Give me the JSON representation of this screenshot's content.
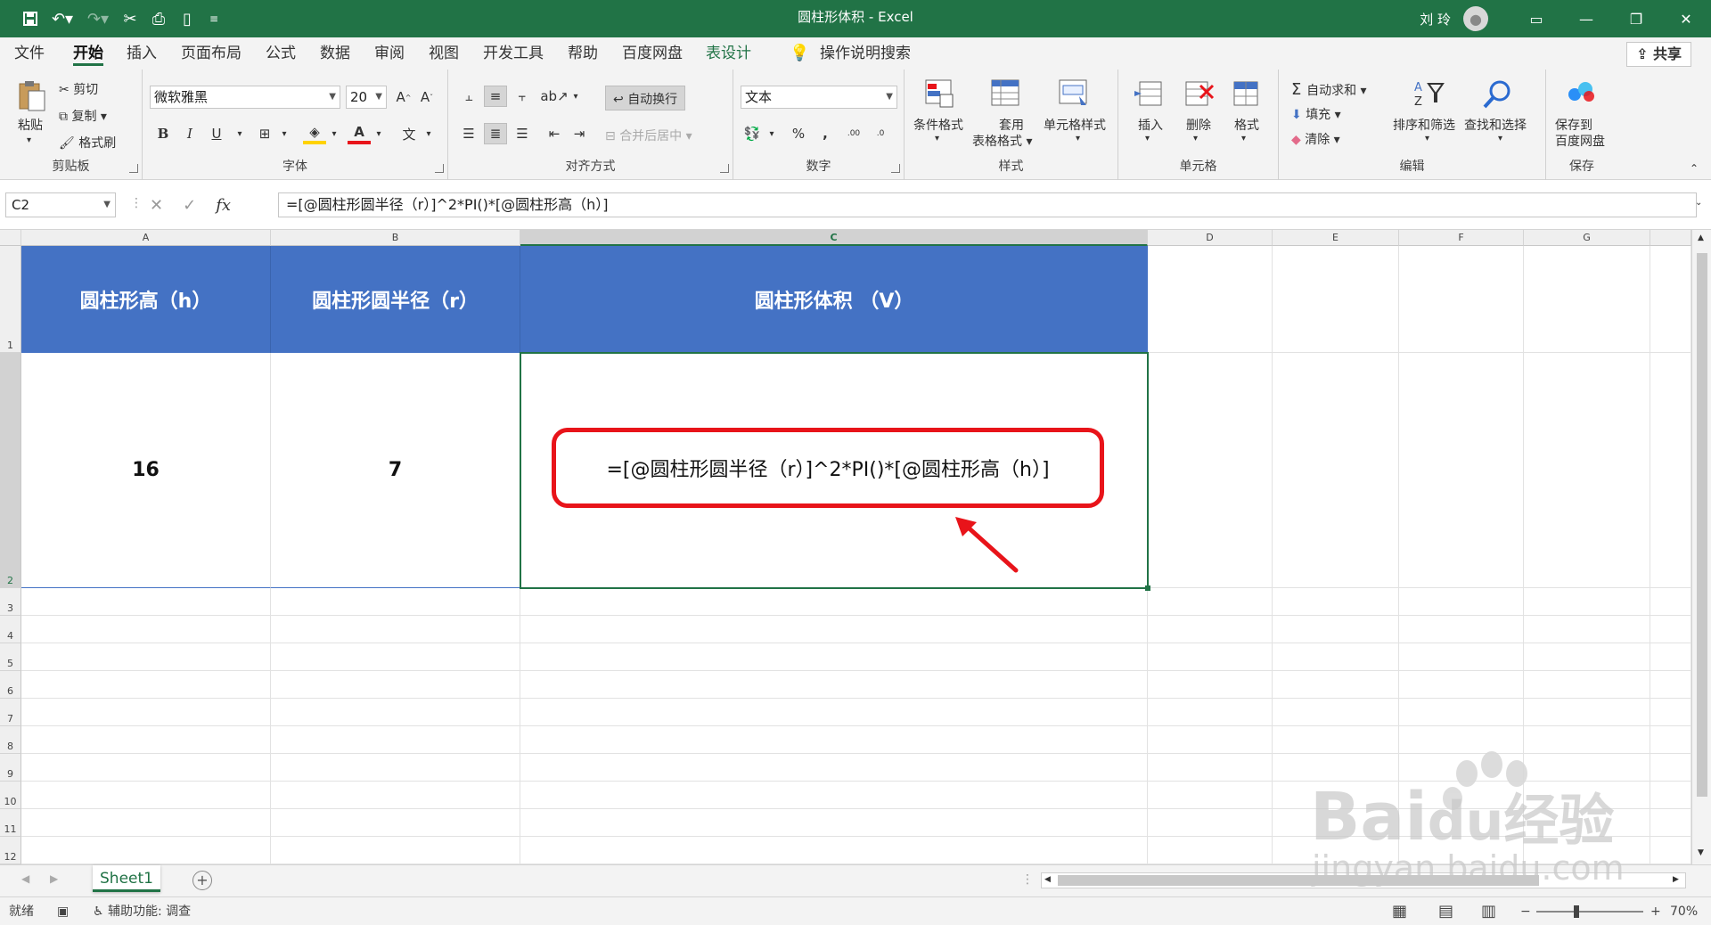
{
  "window": {
    "title": "圆柱形体积 - Excel",
    "user_name": "刘 玲"
  },
  "menu_tabs": [
    {
      "label": "文件"
    },
    {
      "label": "开始"
    },
    {
      "label": "插入"
    },
    {
      "label": "页面布局"
    },
    {
      "label": "公式"
    },
    {
      "label": "数据"
    },
    {
      "label": "审阅"
    },
    {
      "label": "视图"
    },
    {
      "label": "开发工具"
    },
    {
      "label": "帮助"
    },
    {
      "label": "百度网盘"
    },
    {
      "label": "表设计"
    }
  ],
  "tell_me": "操作说明搜索",
  "share_label": "共享",
  "ribbon": {
    "clipboard": {
      "label": "剪贴板",
      "paste": "粘贴",
      "cut": "剪切",
      "copy": "复制",
      "format_painter": "格式刷"
    },
    "font": {
      "label": "字体",
      "font_name": "微软雅黑",
      "font_size": "20",
      "bold": "B",
      "italic": "I",
      "underline": "U",
      "wen": "文"
    },
    "alignment": {
      "label": "对齐方式",
      "wrap_text": "自动换行",
      "merge_center": "合并后居中"
    },
    "number": {
      "label": "数字",
      "format": "文本",
      "percent": "%",
      "comma": ",",
      "inc_decimal": ".00",
      "dec_decimal": ".0"
    },
    "styles": {
      "label": "样式",
      "conditional": "条件格式",
      "table_format_1": "套用",
      "table_format_2": "表格格式",
      "cell_styles": "单元格样式"
    },
    "cells": {
      "label": "单元格",
      "insert": "插入",
      "delete": "删除",
      "format": "格式"
    },
    "editing": {
      "label": "编辑",
      "autosum": "自动求和",
      "fill": "填充",
      "clear": "清除",
      "sort_filter": "排序和筛选",
      "find_select": "查找和选择"
    },
    "save": {
      "label": "保存",
      "save_1": "保存到",
      "save_2": "百度网盘"
    }
  },
  "formula_bar": {
    "name_box": "C2",
    "fx": "fx",
    "formula": "=[@圆柱形圆半径（r）]^2*PI()*[@圆柱形高（h）]"
  },
  "columns": [
    "A",
    "B",
    "C",
    "D",
    "E",
    "F",
    "G"
  ],
  "rows": [
    "1",
    "2",
    "3",
    "4",
    "5",
    "6",
    "7",
    "8",
    "9",
    "10",
    "11",
    "12"
  ],
  "table": {
    "headers": [
      "圆柱形高（h）",
      "圆柱形圆半径（r）",
      "圆柱形体积 （V）"
    ],
    "row1": [
      "16",
      "7"
    ],
    "c2_formula": "=[@圆柱形圆半径（r）]^2*PI()*[@圆柱形高（h）]",
    "header_color": "#4472c4"
  },
  "sheet_tab": "Sheet1",
  "status": {
    "ready": "就绪",
    "accessibility": "辅助功能: 调查",
    "zoom": "70%"
  },
  "watermark": {
    "brand": "Bai",
    "brand_tail": "du",
    "cn": "经验",
    "url": "jingyan.baidu.com"
  },
  "colors": {
    "excel_green": "#217346",
    "annotation_red": "#e8141a"
  }
}
